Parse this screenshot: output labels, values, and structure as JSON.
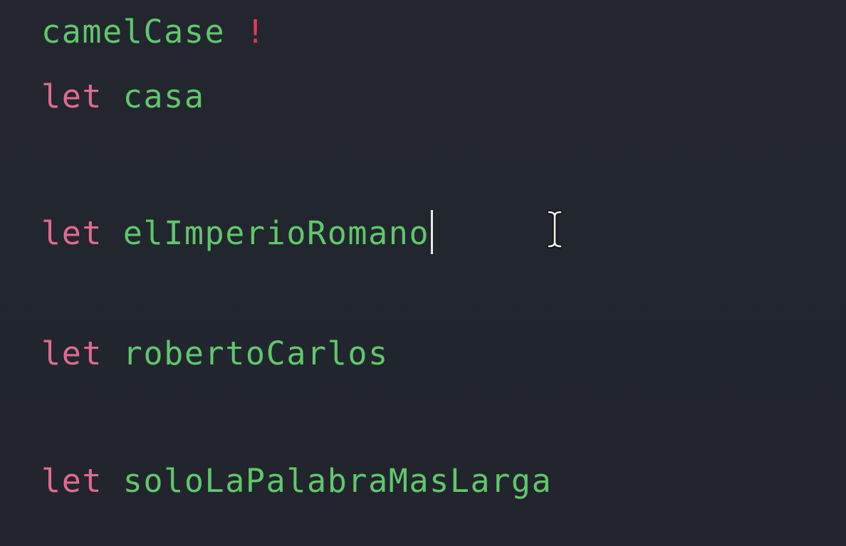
{
  "editor": {
    "lines": [
      {
        "identifier": "camelCase",
        "suffix": "!"
      },
      {
        "keyword": "let",
        "identifier": "casa"
      },
      {
        "keyword": "let",
        "identifier": "elImperioRomano"
      },
      {
        "keyword": "let",
        "identifier": "robertoCarlos"
      },
      {
        "keyword": "let",
        "identifier": "soloLaPalabraMasLarga"
      }
    ]
  },
  "colors": {
    "background": "#22252e",
    "keyword": "#e26a8f",
    "identifier": "#5fc86a",
    "exclamation": "#e23a5a",
    "caret": "#e8e8e8"
  },
  "icons": {
    "mouse_cursor": "i-beam-cursor-icon",
    "text_caret": "text-caret"
  }
}
